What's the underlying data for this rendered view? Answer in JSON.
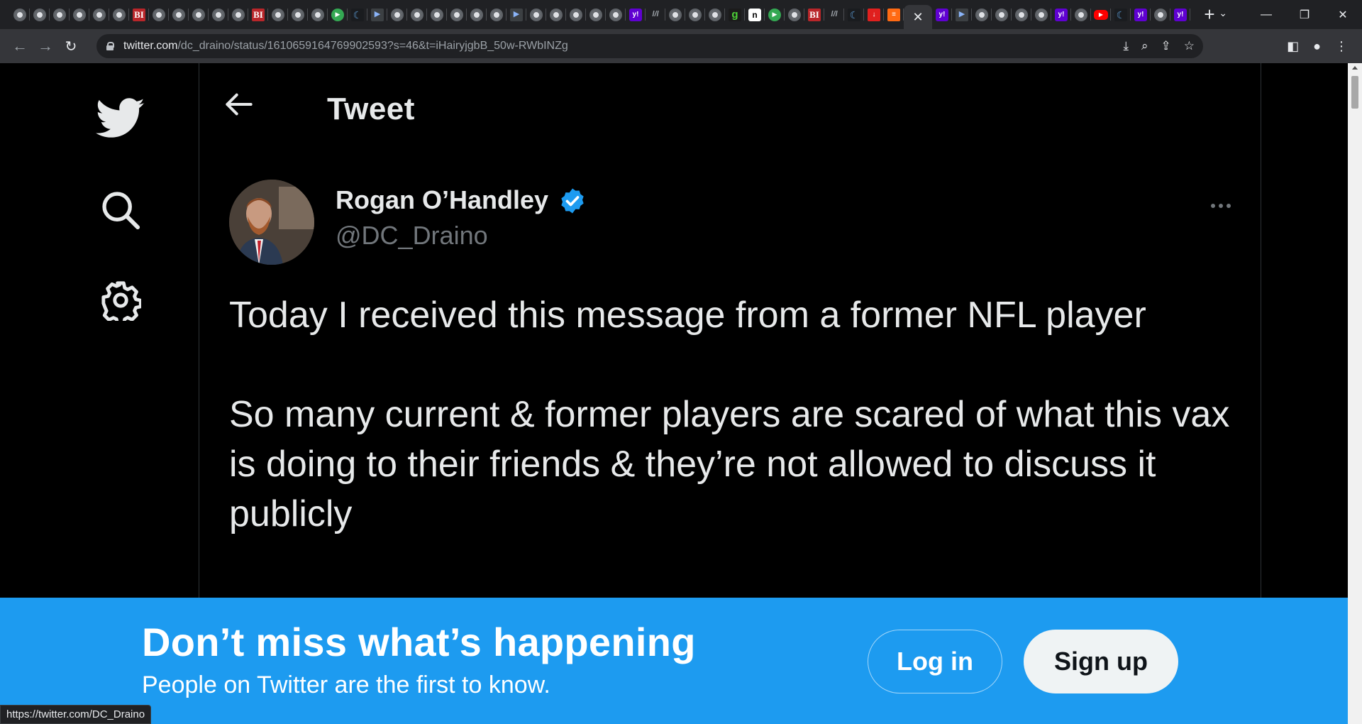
{
  "browser": {
    "tabs": [
      {
        "icon": "globe-icon"
      },
      {
        "icon": "globe-icon"
      },
      {
        "icon": "globe-icon"
      },
      {
        "icon": "globe-icon"
      },
      {
        "icon": "globe-icon"
      },
      {
        "icon": "globe-icon"
      },
      {
        "icon": "bi-icon",
        "glyph": "BI"
      },
      {
        "icon": "globe-icon"
      },
      {
        "icon": "globe-icon"
      },
      {
        "icon": "globe-icon"
      },
      {
        "icon": "globe-icon"
      },
      {
        "icon": "globe-icon"
      },
      {
        "icon": "bi-icon",
        "glyph": "BI"
      },
      {
        "icon": "globe-icon"
      },
      {
        "icon": "globe-icon"
      },
      {
        "icon": "globe-icon"
      },
      {
        "icon": "play-icon",
        "glyph": "▶"
      },
      {
        "icon": "flag-icon",
        "glyph": "☾"
      },
      {
        "icon": "dark-icon",
        "glyph": "▶"
      },
      {
        "icon": "globe-icon"
      },
      {
        "icon": "globe-icon"
      },
      {
        "icon": "globe-icon"
      },
      {
        "icon": "globe-icon"
      },
      {
        "icon": "globe-icon"
      },
      {
        "icon": "globe-icon"
      },
      {
        "icon": "dark-icon",
        "glyph": "▶"
      },
      {
        "icon": "globe-icon"
      },
      {
        "icon": "globe-icon"
      },
      {
        "icon": "globe-icon"
      },
      {
        "icon": "globe-icon"
      },
      {
        "icon": "globe-icon"
      },
      {
        "icon": "yahoo-icon",
        "glyph": "y!"
      },
      {
        "icon": "slash-icon",
        "glyph": "l/l"
      },
      {
        "icon": "globe-icon"
      },
      {
        "icon": "globe-icon"
      },
      {
        "icon": "globe-icon"
      },
      {
        "icon": "g-icon",
        "glyph": "g"
      },
      {
        "icon": "n-icon",
        "glyph": "n"
      },
      {
        "icon": "play-icon",
        "glyph": "▶"
      },
      {
        "icon": "globe-icon"
      },
      {
        "icon": "bi-icon",
        "glyph": "BI"
      },
      {
        "icon": "slash-icon",
        "glyph": "l/l"
      },
      {
        "icon": "flag-icon",
        "glyph": "☾"
      },
      {
        "icon": "red-icon",
        "glyph": "↓"
      },
      {
        "icon": "orange-icon",
        "glyph": "≡"
      }
    ],
    "active_tab_close": "✕",
    "tabs_after": [
      {
        "icon": "yahoo-icon",
        "glyph": "y!"
      },
      {
        "icon": "dark-icon",
        "glyph": "▶"
      },
      {
        "icon": "globe-icon"
      },
      {
        "icon": "globe-icon"
      },
      {
        "icon": "globe-icon"
      },
      {
        "icon": "globe-icon"
      },
      {
        "icon": "yahoo-icon",
        "glyph": "y!"
      },
      {
        "icon": "globe-icon"
      },
      {
        "icon": "youtube-icon",
        "glyph": "▶"
      },
      {
        "icon": "flag-icon",
        "glyph": "☾"
      },
      {
        "icon": "yahoo-icon",
        "glyph": "y!"
      },
      {
        "icon": "globe-icon"
      },
      {
        "icon": "yahoo-icon",
        "glyph": "y!"
      }
    ],
    "new_tab": "+",
    "url_host": "twitter.com",
    "url_path": "/dc_draino/status/1610659164769902593?s=46&t=iHairyjgbB_50w-RWbINZg",
    "status_url": "https://twitter.com/DC_Draino"
  },
  "header": {
    "title": "Tweet"
  },
  "tweet": {
    "author_name": "Rogan O’Handley",
    "handle": "@DC_Draino",
    "paragraphs": [
      "Today I received this message from a former NFL player",
      "So many current & former players are scared of what this vax is doing to their friends & they’re not allowed to discuss it publicly"
    ]
  },
  "bottom_bar": {
    "title": "Don’t miss what’s happening",
    "subtitle": "People on Twitter are the first to know.",
    "login_label": "Log in",
    "signup_label": "Sign up"
  },
  "colors": {
    "accent": "#1d9bf0",
    "background": "#000000",
    "text_primary": "#e7e9ea",
    "text_secondary": "#71767b"
  }
}
